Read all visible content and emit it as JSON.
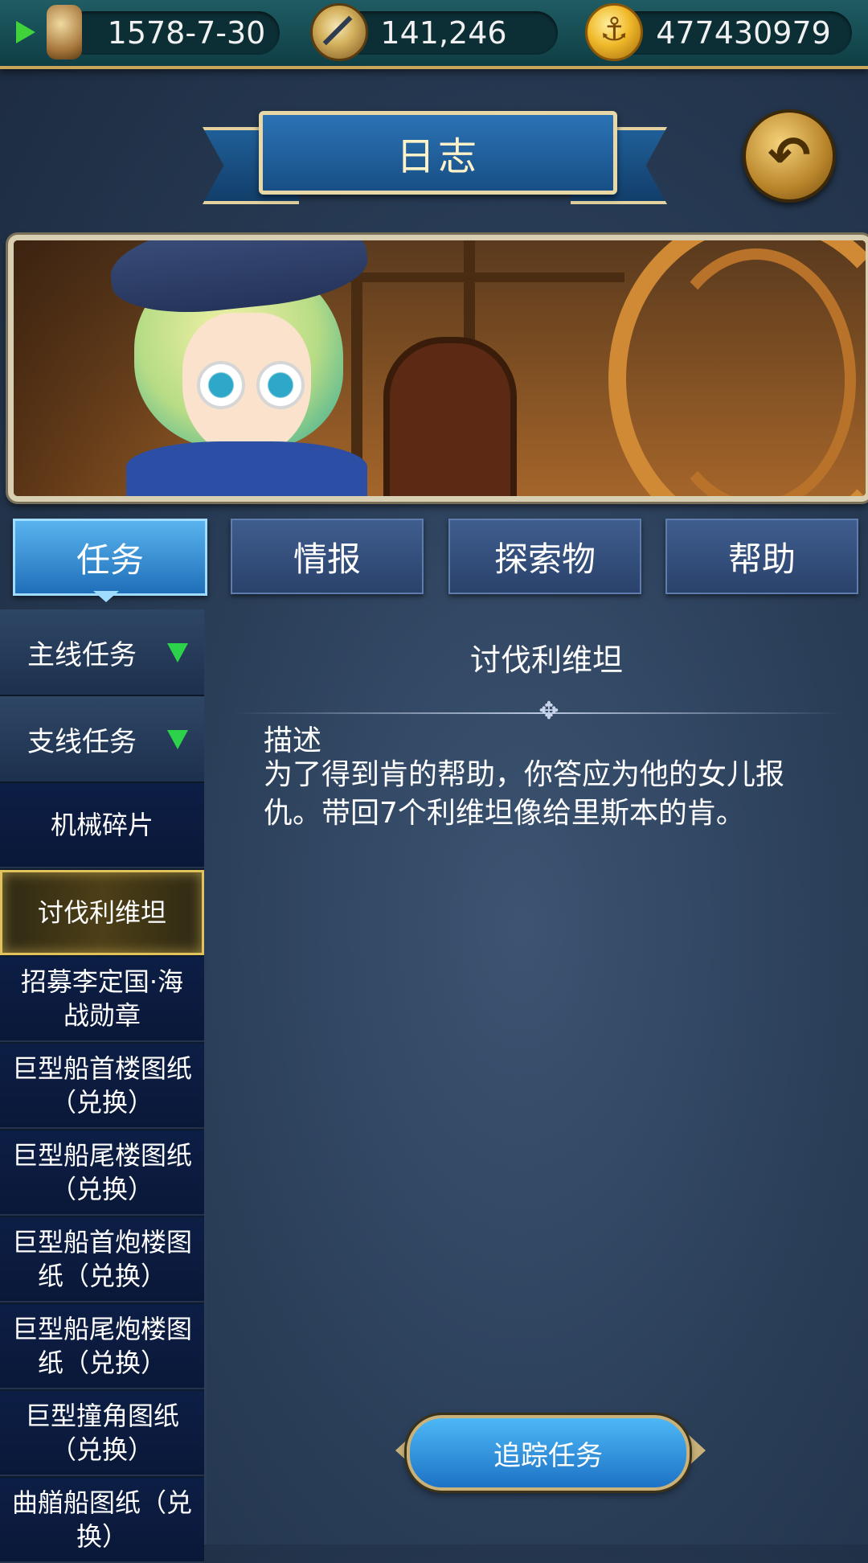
{
  "topbar": {
    "date": "1578-7-30",
    "fame": "141,246",
    "gold": "477430979",
    "icons": [
      "play-icon",
      "hourglass-icon",
      "compass-icon",
      "anchor-coin-icon"
    ]
  },
  "header": {
    "title": "日志",
    "back_icon": "↶"
  },
  "tabs": [
    {
      "label": "任务",
      "active": true
    },
    {
      "label": "情报",
      "active": false
    },
    {
      "label": "探索物",
      "active": false
    },
    {
      "label": "帮助",
      "active": false
    }
  ],
  "sidebar": {
    "categories": [
      {
        "label": "主线任务"
      },
      {
        "label": "支线任务"
      }
    ],
    "items": [
      {
        "label": "机械碎片"
      },
      {
        "label": "讨伐利维坦",
        "selected": true
      },
      {
        "label": "招募李定国·海战勋章"
      },
      {
        "label": "巨型船首楼图纸（兑换）"
      },
      {
        "label": "巨型船尾楼图纸（兑换）"
      },
      {
        "label": "巨型船首炮楼图纸（兑换）"
      },
      {
        "label": "巨型船尾炮楼图纸（兑换）"
      },
      {
        "label": "巨型撞角图纸（兑换）"
      },
      {
        "label": "曲艏船图纸（兑换）"
      }
    ]
  },
  "detail": {
    "title": "讨伐利维坦",
    "heading": "描述",
    "body": "为了得到肯的帮助，你答应为他的女儿报仇。带回7个利维坦像给里斯本的肯。"
  },
  "actions": {
    "track_label": "追踪任务"
  },
  "colors": {
    "accent_green": "#2cd24a",
    "gold_border": "#c9a55a",
    "active_tab": "#1f6fb8"
  }
}
